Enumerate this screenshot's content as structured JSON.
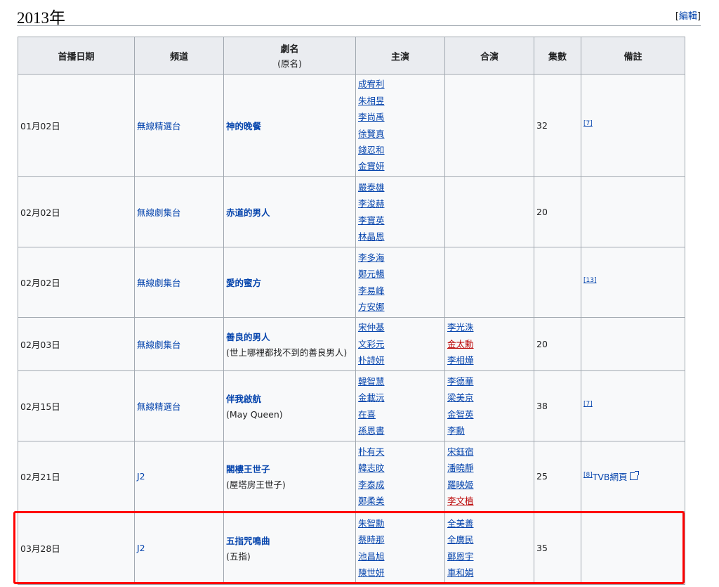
{
  "section": {
    "title": "2013年",
    "edit_open": "[",
    "edit_label": "編輯",
    "edit_close": "]"
  },
  "table": {
    "headers": {
      "date": "首播日期",
      "channel": "頻道",
      "title": "劇名",
      "title_sub": "(原名)",
      "lead": "主演",
      "support": "合演",
      "episodes": "集數",
      "notes": "備註"
    },
    "rows": [
      {
        "date": "01月02日",
        "channel": "無線精選台",
        "title": "神的晚餐",
        "original": "",
        "lead": [
          "成宥利",
          "朱相昱",
          "李尚禹",
          "徐賢真",
          "錢忍和",
          "金寶妍"
        ],
        "support": [],
        "episodes": "32",
        "note_ref": "[7]",
        "note_link": ""
      },
      {
        "date": "02月02日",
        "channel": "無線劇集台",
        "title": "赤道的男人",
        "original": "",
        "lead": [
          "嚴泰雄",
          "李浚赫",
          "李寶英",
          "林晶恩"
        ],
        "support": [],
        "episodes": "20",
        "note_ref": "",
        "note_link": ""
      },
      {
        "date": "02月02日",
        "channel": "無線劇集台",
        "title": "愛的蜜方",
        "original": "",
        "lead": [
          "李多海",
          "鄭元暢",
          "李易峰",
          "方安娜"
        ],
        "support": [],
        "episodes": "",
        "note_ref": "[13]",
        "note_link": ""
      },
      {
        "date": "02月03日",
        "channel": "無線劇集台",
        "title": "善良的男人",
        "original": "(世上哪裡都找不到的善良男人)",
        "lead": [
          "宋仲基",
          "文彩元",
          "朴詩妍"
        ],
        "support": [
          "李光洙",
          "金太勳",
          "李相燁"
        ],
        "episodes": "20",
        "note_ref": "",
        "note_link": ""
      },
      {
        "date": "02月15日",
        "channel": "無線精選台",
        "title": "伴我啟航",
        "original": "(May Queen)",
        "lead": [
          "韓智慧",
          "金載沅",
          "在喜",
          "孫恩書"
        ],
        "support": [
          "李德華",
          "梁美京",
          "金智英",
          "李勳"
        ],
        "episodes": "38",
        "note_ref": "[7]",
        "note_link": ""
      },
      {
        "date": "02月21日",
        "channel": "J2",
        "title": "閣樓王世子",
        "original": "(屋塔房王世子)",
        "lead": [
          "朴有天",
          "韓志旼",
          "李泰成",
          "鄭柔美"
        ],
        "support": [
          "宋鈺宿",
          "潘曉靜",
          "羅映姬",
          "李文植"
        ],
        "episodes": "25",
        "note_ref": "[8]",
        "note_link": "TVB網頁"
      },
      {
        "date": "03月28日",
        "channel": "J2",
        "title": "五指咒鳴曲",
        "original": "(五指)",
        "lead": [
          "朱智勳",
          "蔡時那",
          "池昌旭",
          "陳世妍"
        ],
        "support": [
          "全美善",
          "全廣民",
          "鄭恩宇",
          "車和娟"
        ],
        "episodes": "35",
        "note_ref": "",
        "note_link": ""
      }
    ]
  },
  "colors": {
    "link": "#0645ad",
    "redlink": "#ba0000",
    "highlight": "#ff0000"
  }
}
